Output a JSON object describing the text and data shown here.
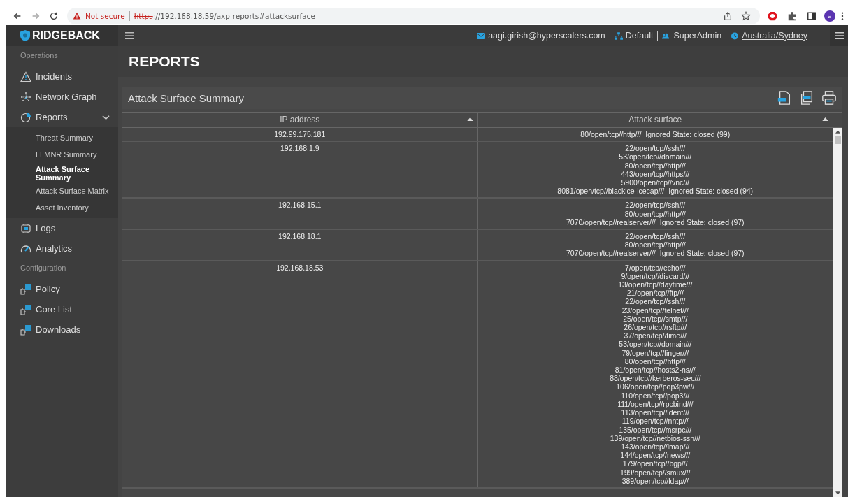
{
  "browser": {
    "security": "Not secure",
    "url_scheme": "https",
    "url_rest": "://192.168.18.59/axp-reports#attacksurface",
    "avatar": "a"
  },
  "brand": "RIDGEBACK",
  "header": {
    "email": "aagi.girish@hyperscalers.com",
    "tenant": "Default",
    "role": "SuperAdmin",
    "timezone": "Australia/Sydney"
  },
  "sidebar": [
    {
      "kind": "section",
      "label": "Operations"
    },
    {
      "kind": "item",
      "label": "Incidents"
    },
    {
      "kind": "item",
      "label": "Network Graph"
    },
    {
      "kind": "item",
      "label": "Reports",
      "expanded": true,
      "children": [
        {
          "label": "Threat Summary",
          "selected": false
        },
        {
          "label": "LLMNR Summary",
          "selected": false
        },
        {
          "label": "Attack Surface Summary",
          "selected": true
        },
        {
          "label": "Attack Surface Matrix",
          "selected": false
        },
        {
          "label": "Asset Inventory",
          "selected": false
        }
      ]
    },
    {
      "kind": "item",
      "label": "Logs"
    },
    {
      "kind": "item",
      "label": "Analytics"
    },
    {
      "kind": "section",
      "label": "Configuration"
    },
    {
      "kind": "item",
      "label": "Policy"
    },
    {
      "kind": "item",
      "label": "Core List"
    },
    {
      "kind": "item",
      "label": "Downloads"
    }
  ],
  "page_title": "REPORTS",
  "panel": {
    "title": "Attack Surface Summary",
    "table": {
      "columns": [
        "IP address",
        "Attack surface"
      ],
      "rows": [
        {
          "ip": "192.99.175.181",
          "ports": [
            "80/open/tcp//http///"
          ],
          "ignored": "Ignored State: closed (99)"
        },
        {
          "ip": "192.168.1.9",
          "ports": [
            "22/open/tcp//ssh///",
            "53/open/tcp//domain///",
            "80/open/tcp//http///",
            "443/open/tcp//https///",
            "5900/open/tcp//vnc///",
            "8081/open/tcp//blackice-icecap///"
          ],
          "ignored": "Ignored State: closed (94)"
        },
        {
          "ip": "192.168.15.1",
          "ports": [
            "22/open/tcp//ssh///",
            "80/open/tcp//http///",
            "7070/open/tcp//realserver///"
          ],
          "ignored": "Ignored State: closed (97)"
        },
        {
          "ip": "192.168.18.1",
          "ports": [
            "22/open/tcp//ssh///",
            "80/open/tcp//http///",
            "7070/open/tcp//realserver///"
          ],
          "ignored": "Ignored State: closed (97)"
        },
        {
          "ip": "192.168.18.53",
          "ports": [
            "7/open/tcp//echo///",
            "9/open/tcp//discard///",
            "13/open/tcp//daytime///",
            "21/open/tcp//ftp///",
            "22/open/tcp//ssh///",
            "23/open/tcp//telnet///",
            "25/open/tcp//smtp///",
            "26/open/tcp//rsftp///",
            "37/open/tcp//time///",
            "53/open/tcp//domain///",
            "79/open/tcp//finger///",
            "80/open/tcp//http///",
            "81/open/tcp//hosts2-ns///",
            "88/open/tcp//kerberos-sec///",
            "106/open/tcp//pop3pw///",
            "110/open/tcp//pop3///",
            "111/open/tcp//rpcbind///",
            "113/open/tcp//ident///",
            "119/open/tcp//nntp///",
            "135/open/tcp//msrpc///",
            "139/open/tcp//netbios-ssn///",
            "143/open/tcp//imap///",
            "144/open/tcp//news///",
            "179/open/tcp//bgp///",
            "199/open/tcp//smux///",
            "389/open/tcp//ldap///"
          ]
        }
      ]
    }
  }
}
